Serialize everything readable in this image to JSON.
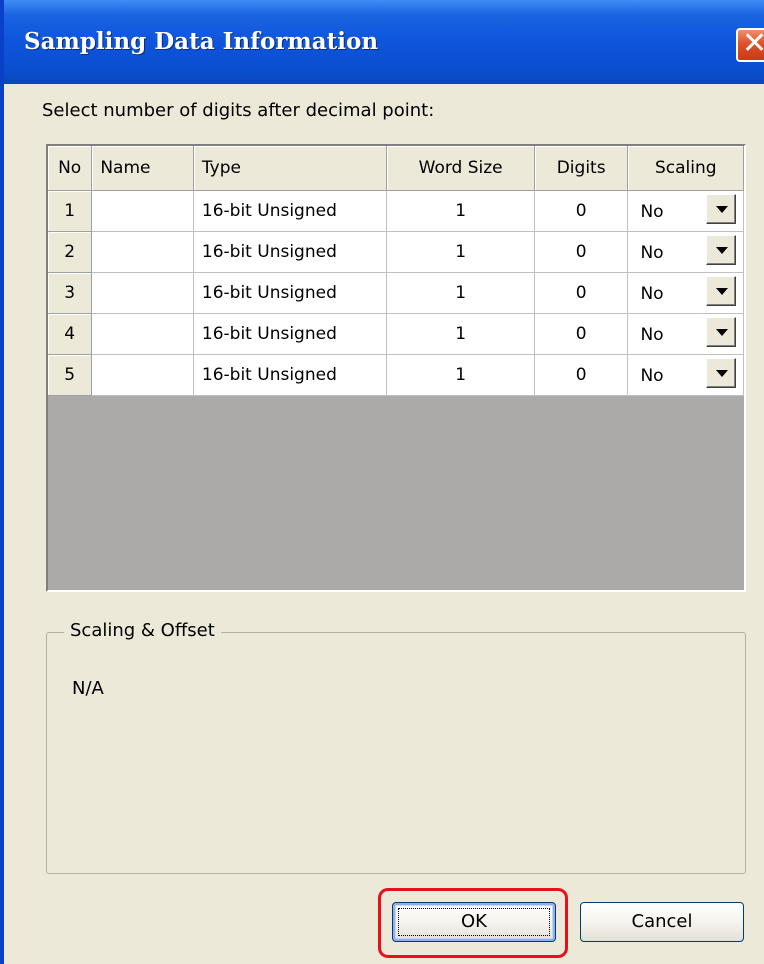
{
  "window": {
    "title": "Sampling Data Information"
  },
  "prompt": "Select number of digits after decimal point:",
  "grid": {
    "columns": [
      "No",
      "Name",
      "Type",
      "Word Size",
      "Digits",
      "Scaling"
    ],
    "rows": [
      {
        "no": "1",
        "name": "",
        "type": "16-bit Unsigned",
        "word_size": "1",
        "digits": "0",
        "scaling": "No"
      },
      {
        "no": "2",
        "name": "",
        "type": "16-bit Unsigned",
        "word_size": "1",
        "digits": "0",
        "scaling": "No"
      },
      {
        "no": "3",
        "name": "",
        "type": "16-bit Unsigned",
        "word_size": "1",
        "digits": "0",
        "scaling": "No"
      },
      {
        "no": "4",
        "name": "",
        "type": "16-bit Unsigned",
        "word_size": "1",
        "digits": "0",
        "scaling": "No"
      },
      {
        "no": "5",
        "name": "",
        "type": "16-bit Unsigned",
        "word_size": "1",
        "digits": "0",
        "scaling": "No"
      }
    ]
  },
  "scaling_group": {
    "legend": "Scaling & Offset",
    "text": "N/A"
  },
  "buttons": {
    "ok": "OK",
    "cancel": "Cancel"
  },
  "colors": {
    "title_bar": "#0d55dc",
    "highlight": "#e8101a",
    "dialog_bg": "#ece9d8"
  }
}
